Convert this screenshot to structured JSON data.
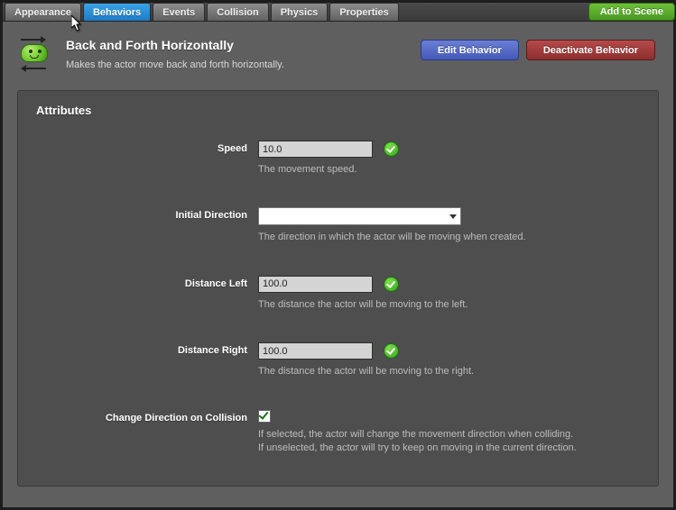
{
  "tabs": [
    {
      "label": "Appearance",
      "active": false
    },
    {
      "label": "Behaviors",
      "active": true
    },
    {
      "label": "Events",
      "active": false
    },
    {
      "label": "Collision",
      "active": false
    },
    {
      "label": "Physics",
      "active": false
    },
    {
      "label": "Properties",
      "active": false
    }
  ],
  "add_to_scene_label": "Add to Scene",
  "header": {
    "title": "Back and Forth Horizontally",
    "subtitle": "Makes the actor move back and forth horizontally.",
    "edit_btn": "Edit Behavior",
    "deactivate_btn": "Deactivate Behavior"
  },
  "panel": {
    "title": "Attributes",
    "speed": {
      "label": "Speed",
      "value": "10.0",
      "desc": "The movement speed."
    },
    "initial_direction": {
      "label": "Initial Direction",
      "value": "",
      "desc": "The direction in which the actor will be moving when created."
    },
    "distance_left": {
      "label": "Distance Left",
      "value": "100.0",
      "desc": "The distance the actor will be moving to the left."
    },
    "distance_right": {
      "label": "Distance Right",
      "value": "100.0",
      "desc": "The distance the actor will be moving to the right."
    },
    "change_dir": {
      "label": "Change Direction on Collision",
      "checked": true,
      "desc_line1": "If selected, the actor will change the movement direction when colliding.",
      "desc_line2": "If unselected, the actor will try to keep on moving in the current direction."
    }
  }
}
